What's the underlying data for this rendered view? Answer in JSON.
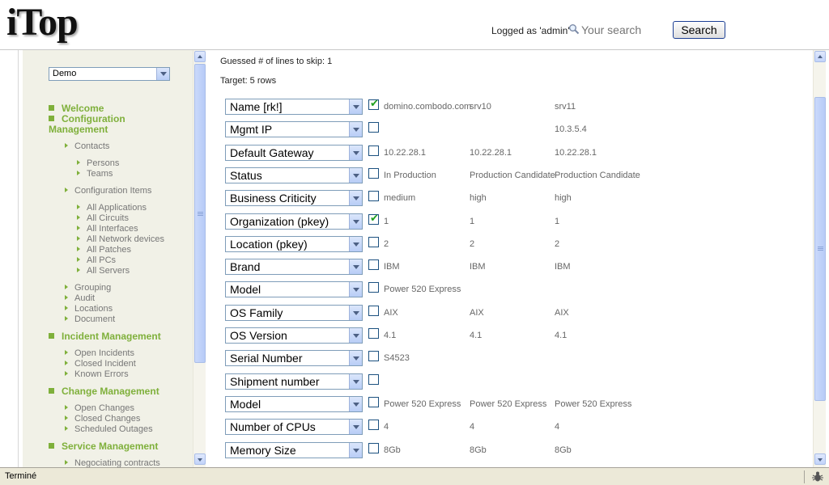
{
  "header": {
    "logo": "iTop",
    "logged_as": "Logged as 'admin'",
    "search_placeholder": "Your search",
    "search_button": "Search"
  },
  "menu": {
    "organization_select": "Demo",
    "welcome": "Welcome",
    "configuration_management": "Configuration Management",
    "contacts": "Contacts",
    "persons": "Persons",
    "teams": "Teams",
    "configuration_items": "Configuration Items",
    "all_applications": "All Applications",
    "all_circuits": "All Circuits",
    "all_interfaces": "All Interfaces",
    "all_network_devices": "All Network devices",
    "all_patches": "All Patches",
    "all_pcs": "All PCs",
    "all_servers": "All Servers",
    "grouping": "Grouping",
    "audit": "Audit",
    "locations": "Locations",
    "document": "Document",
    "incident_management": "Incident Management",
    "open_incidents": "Open Incidents",
    "closed_incident": "Closed Incident",
    "known_errors": "Known Errors",
    "change_management": "Change Management",
    "open_changes": "Open Changes",
    "closed_changes": "Closed Changes",
    "scheduled_outages": "Scheduled Outages",
    "service_management": "Service Management",
    "negociating_contracts": "Negociating contracts"
  },
  "import": {
    "guessed_lines": "Guessed # of lines to skip: 1",
    "target": "Target: 5 rows",
    "rows": [
      {
        "field": "Name [rk!]",
        "checked": true,
        "values": [
          "domino.combodo.com",
          "srv10",
          "srv11"
        ]
      },
      {
        "field": "Mgmt IP",
        "checked": false,
        "values": [
          "",
          "",
          "10.3.5.4"
        ]
      },
      {
        "field": "Default Gateway",
        "checked": false,
        "values": [
          "10.22.28.1",
          "10.22.28.1",
          "10.22.28.1"
        ]
      },
      {
        "field": "Status",
        "checked": false,
        "values": [
          "In Production",
          "Production Candidate",
          "Production Candidate"
        ]
      },
      {
        "field": "Business Criticity",
        "checked": false,
        "values": [
          "medium",
          "high",
          "high"
        ]
      },
      {
        "field": "Organization (pkey)",
        "checked": true,
        "values": [
          "1",
          "1",
          "1"
        ]
      },
      {
        "field": "Location (pkey)",
        "checked": false,
        "values": [
          "2",
          "2",
          "2"
        ]
      },
      {
        "field": "Brand",
        "checked": false,
        "values": [
          "IBM",
          "IBM",
          "IBM"
        ]
      },
      {
        "field": "Model",
        "checked": false,
        "values": [
          "Power 520 Express",
          "",
          ""
        ]
      },
      {
        "field": "OS Family",
        "checked": false,
        "values": [
          "AIX",
          "AIX",
          "AIX"
        ]
      },
      {
        "field": "OS Version",
        "checked": false,
        "values": [
          "4.1",
          "4.1",
          "4.1"
        ]
      },
      {
        "field": "Serial Number",
        "checked": false,
        "values": [
          "S4523",
          "",
          ""
        ]
      },
      {
        "field": "Shipment number",
        "checked": false,
        "values": [
          "",
          "",
          ""
        ]
      },
      {
        "field": "Model",
        "checked": false,
        "values": [
          "Power 520 Express",
          "Power 520 Express",
          "Power 520 Express"
        ]
      },
      {
        "field": "Number of CPUs",
        "checked": false,
        "values": [
          "4",
          "4",
          "4"
        ]
      },
      {
        "field": "Memory Size",
        "checked": false,
        "values": [
          "8Gb",
          "8Gb",
          "8Gb"
        ]
      }
    ]
  },
  "statusbar": {
    "text": "Terminé"
  },
  "colors": {
    "menu_green": "#7fb03b",
    "menu_background": "#f1f1e7",
    "checkmark_green": "#21a121"
  }
}
